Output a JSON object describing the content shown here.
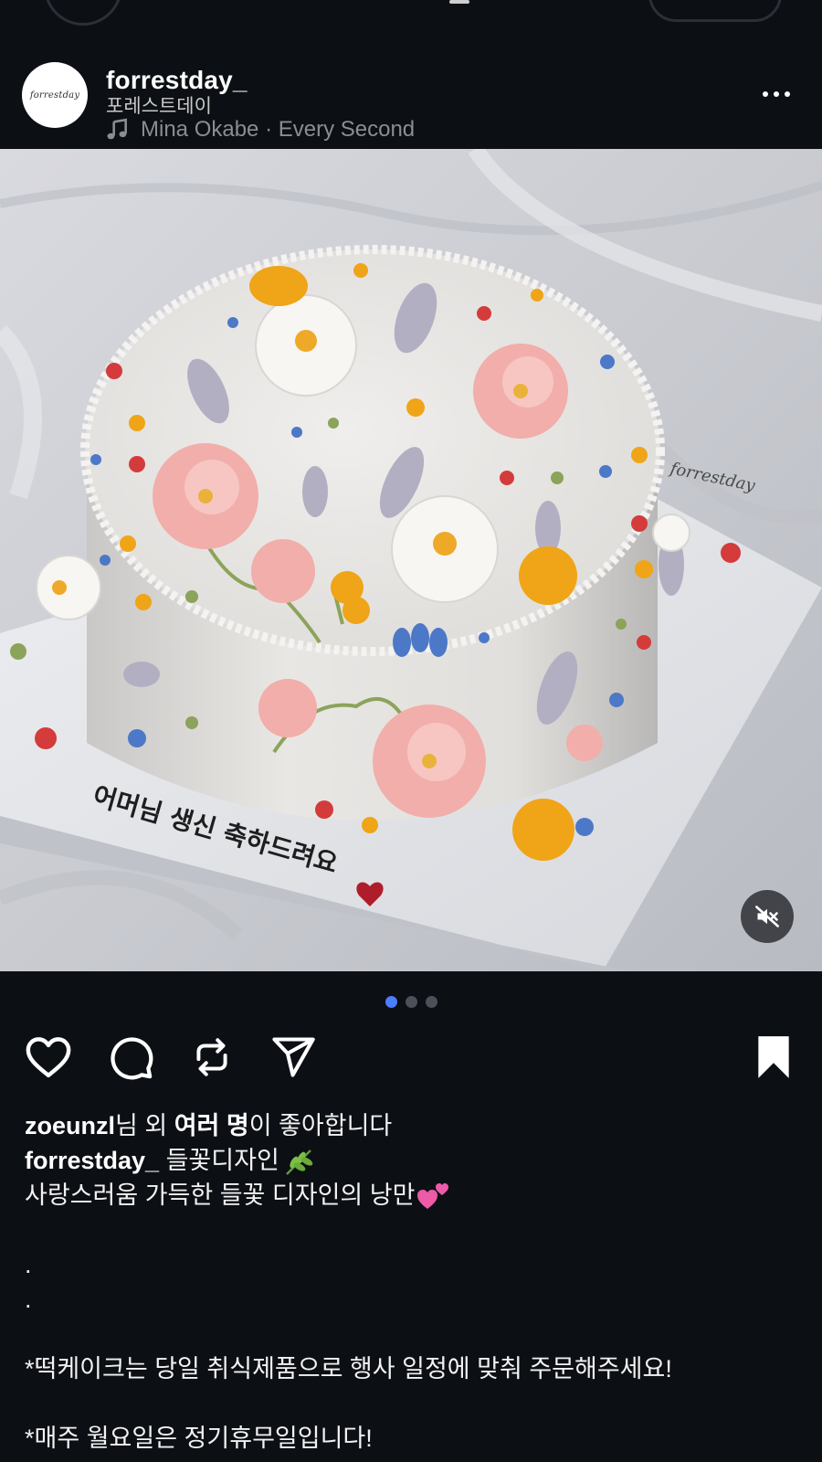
{
  "post": {
    "username": "forrestday_",
    "display_name": "포레스트데이",
    "avatar_text": "forrestday",
    "music": "Mina Okabe · Every Second"
  },
  "photo": {
    "board_text": "forrestday",
    "cake_message": "어머님 생신 축하드려요"
  },
  "carousel": {
    "count": 3,
    "active_index": 0
  },
  "likes": {
    "user": "zoeunzl",
    "suffix_1": "님 외 ",
    "bold_2": "여러 명",
    "suffix_2": "이 좋아합니다"
  },
  "caption": {
    "user": "forrestday_",
    "title": " 들꽃디자인",
    "line2": "사랑스러움 가득한 들꽃 디자인의 낭만",
    "dot1": ".",
    "dot2": ".",
    "note1": "*떡케이크는 당일 취식제품으로 행사 일정에 맞춰 주문해주세요!",
    "note2": "*매주 월요일은 정기휴무일입니다!"
  },
  "icons": {
    "like": "heart-icon",
    "comment": "comment-icon",
    "repost": "repost-icon",
    "share": "send-icon",
    "save": "bookmark-icon",
    "more": "more-icon",
    "mute": "muted-speaker-icon",
    "music": "music-note-icon"
  },
  "colors": {
    "background": "#0c0f14",
    "active_dot": "#4d7cff",
    "inactive_dot": "#4c5058"
  }
}
